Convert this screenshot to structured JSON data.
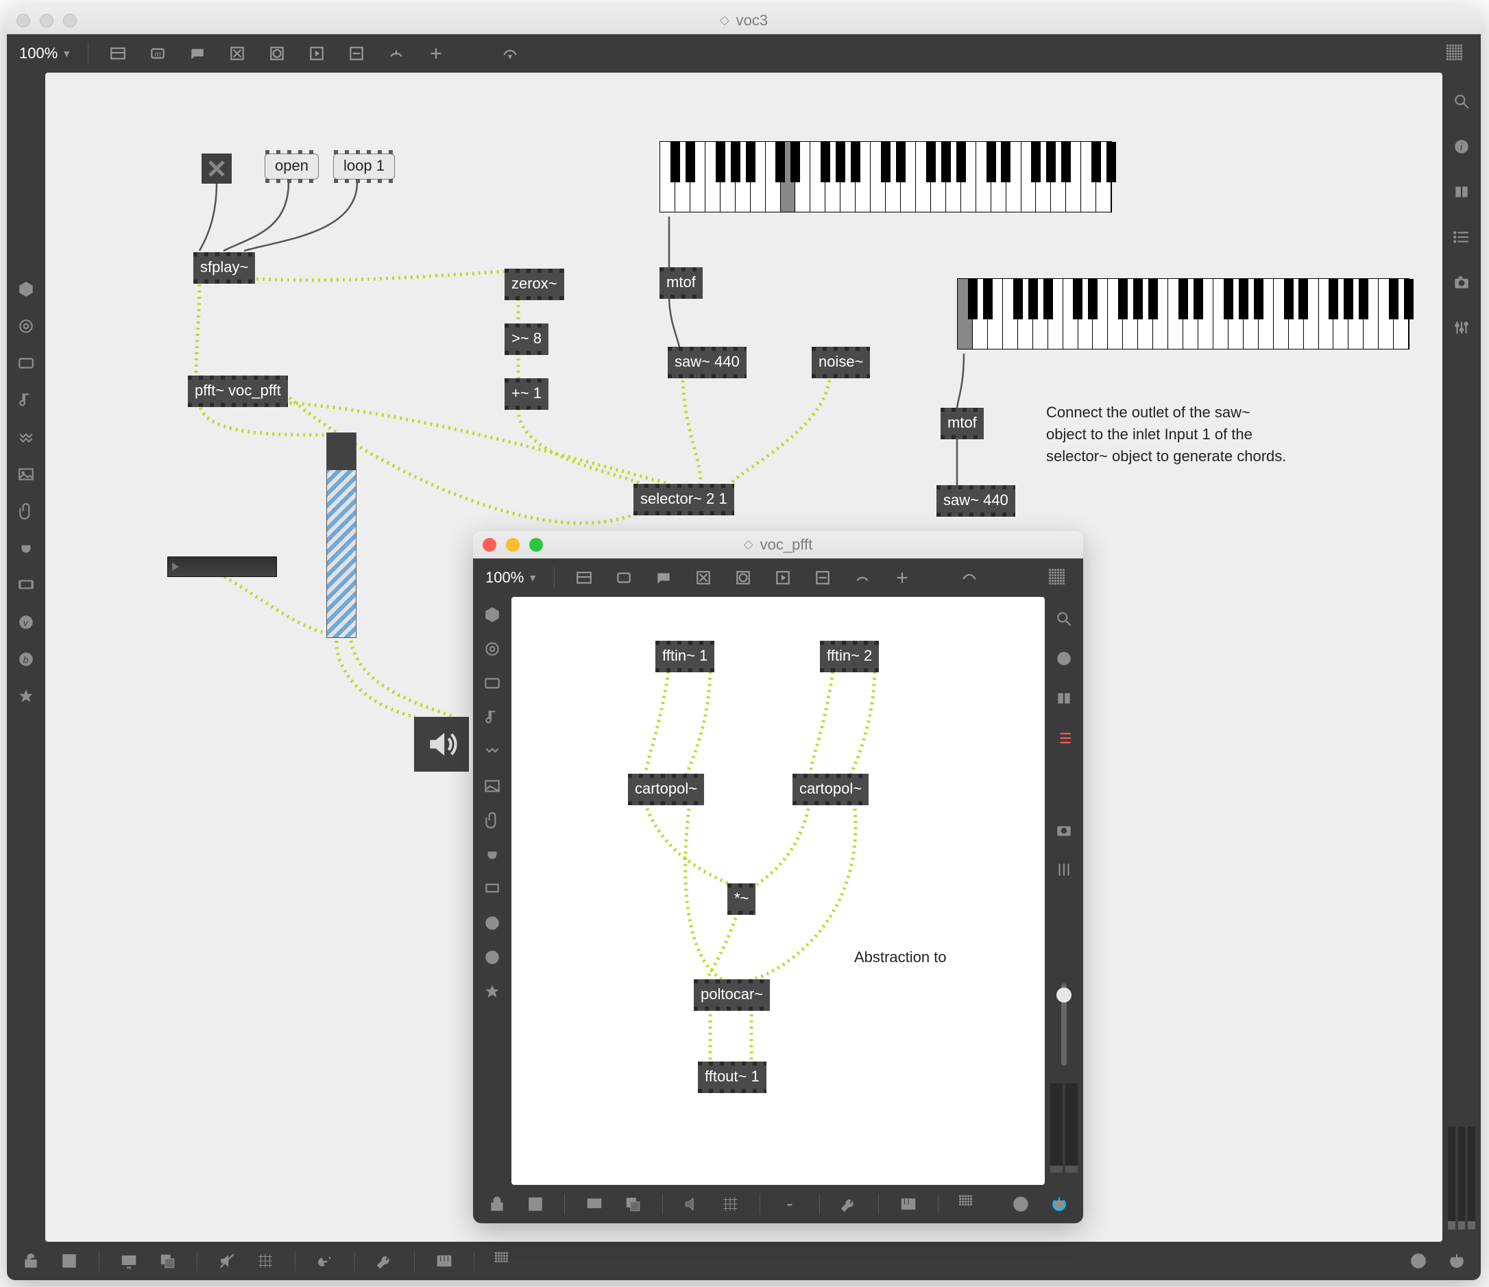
{
  "main_window": {
    "title": "voc3",
    "zoom": "100%",
    "toolbar_icons": [
      "layout",
      "m-box",
      "comment",
      "x-box",
      "o-box",
      "play-box",
      "minus-box",
      "dial",
      "plus",
      "paint"
    ],
    "left_palette": [
      "cube",
      "circle",
      "panel",
      "note",
      "steps",
      "image",
      "clip",
      "plug",
      "screen",
      "v-circle",
      "b-circle",
      "star"
    ],
    "right_palette": [
      "search",
      "info",
      "split",
      "list",
      "camera",
      "sliders"
    ],
    "bottombar_left": [
      "lock",
      "select",
      "present",
      "dup",
      "mute",
      "grid",
      "gridplus",
      "wrench",
      "piano",
      "matrix"
    ],
    "bottombar_right": [
      "engine",
      "power"
    ]
  },
  "objects": {
    "open_msg": "open",
    "loop_msg": "loop 1",
    "sfplay": "sfplay~",
    "pfft": "pfft~ voc_pfft",
    "zerox": "zerox~",
    "gt": ">~ 8",
    "plus": "+~ 1",
    "selector": "selector~ 2 1",
    "mtof1": "mtof",
    "saw1": "saw~ 440",
    "noise": "noise~",
    "mtof2": "mtof",
    "saw2": "saw~ 440"
  },
  "comment_main": "Connect the outlet of the saw~ object to the inlet Input 1 of the selector~ object to generate chords.",
  "sub_window": {
    "title": "voc_pfft",
    "zoom": "100%",
    "objects": {
      "fftin1": "fftin~ 1",
      "fftin2": "fftin~ 2",
      "cartopol1": "cartopol~",
      "cartopol2": "cartopol~",
      "mul": "*~",
      "poltocar": "poltocar~",
      "fftout": "fftout~ 1"
    },
    "comment": "Abstraction to"
  }
}
